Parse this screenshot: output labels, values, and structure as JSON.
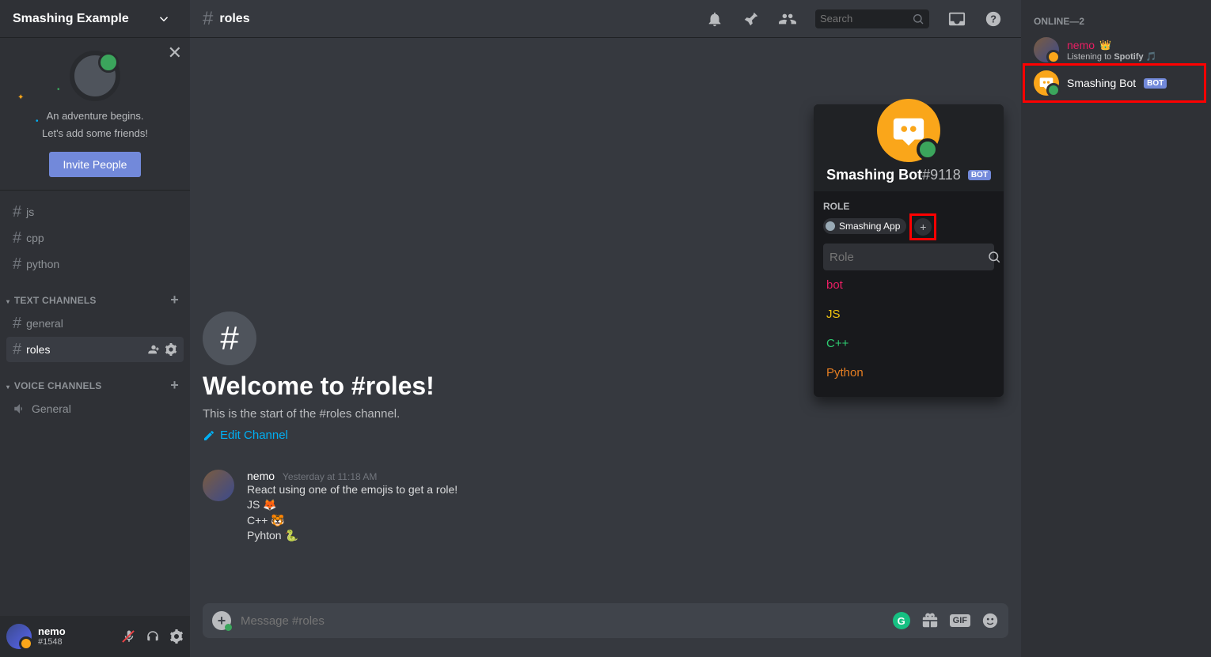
{
  "server": {
    "name": "Smashing Example"
  },
  "invite": {
    "line1": "An adventure begins.",
    "line2": "Let's add some friends!",
    "button": "Invite People"
  },
  "categories": {
    "text": {
      "label": "TEXT CHANNELS"
    },
    "voice": {
      "label": "VOICE CHANNELS"
    }
  },
  "channels": {
    "text_misc": [
      {
        "name": "js"
      },
      {
        "name": "cpp"
      },
      {
        "name": "python"
      }
    ],
    "text_main": [
      {
        "name": "general"
      },
      {
        "name": "roles",
        "active": true
      }
    ],
    "voice": [
      {
        "name": "General"
      }
    ]
  },
  "me": {
    "username": "nemo",
    "discriminator": "#1548"
  },
  "header": {
    "channel": "roles",
    "search_placeholder": "Search"
  },
  "welcome": {
    "title": "Welcome to #roles!",
    "subtitle": "This is the start of the #roles channel.",
    "edit": "Edit Channel"
  },
  "message": {
    "author": "nemo",
    "timestamp": "Yesterday at 11:18 AM",
    "line1": "React using one of the emojis to get a role!",
    "line2": "JS 🦊",
    "line3": "C++ 🐯",
    "line4": "Pyhton 🐍"
  },
  "composer": {
    "placeholder": "Message #roles",
    "gif": "GIF"
  },
  "members": {
    "header": "ONLINE—2",
    "nemo": {
      "name": "nemo",
      "status_prefix": "Listening to ",
      "status_app": "Spotify"
    },
    "bot": {
      "name": "Smashing Bot",
      "badge": "BOT"
    }
  },
  "popout": {
    "name": "Smashing Bot",
    "discriminator": "#9118",
    "badge": "BOT",
    "role_section": "ROLE",
    "role_chip": "Smashing App",
    "search_placeholder": "Role",
    "options": {
      "bot": "bot",
      "js": "JS",
      "cpp": "C++",
      "python": "Python"
    }
  }
}
